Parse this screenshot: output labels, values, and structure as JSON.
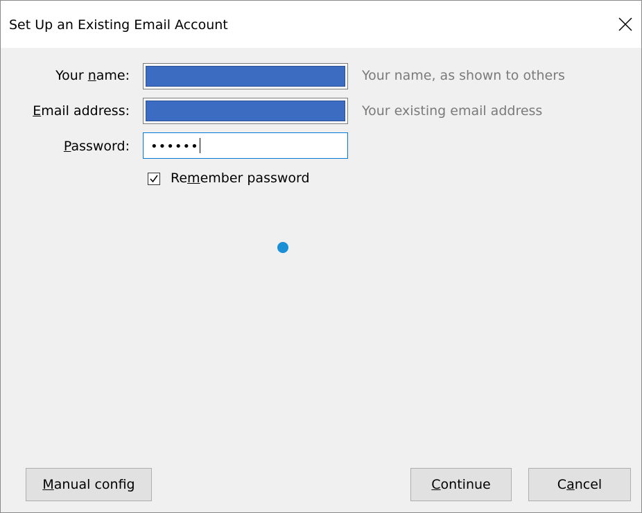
{
  "dialog": {
    "title": "Set Up an Existing Email Account"
  },
  "form": {
    "name_label": "Your name:",
    "name_hint": "Your name, as shown to others",
    "email_label": "Email address:",
    "email_hint": "Your existing email address",
    "password_label": "Password:",
    "password_value": "••••••",
    "remember_label": "Remember password",
    "remember_checked": true
  },
  "buttons": {
    "manual_config": "Manual config",
    "continue": "Continue",
    "cancel": "Cancel"
  },
  "colors": {
    "redacted_fill": "#3c6bc2",
    "focus_border": "#0078d7",
    "spinner": "#1a8fd6"
  }
}
